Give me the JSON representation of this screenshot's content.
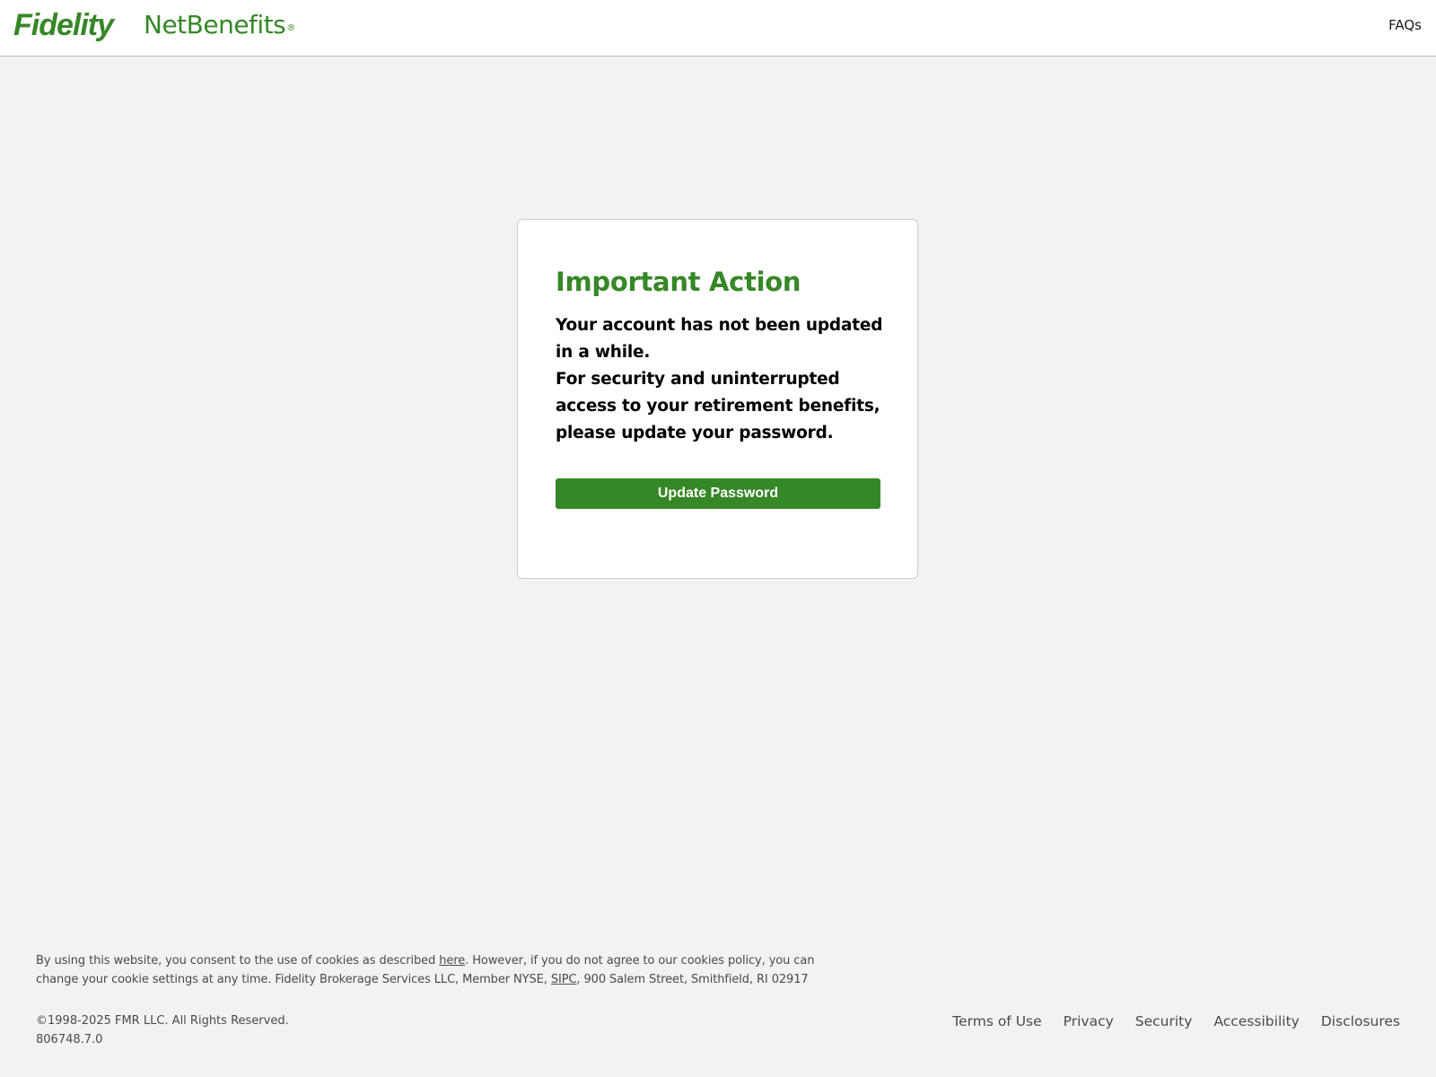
{
  "header": {
    "logo_primary": "Fidelity",
    "logo_secondary": "NetBenefits",
    "logo_registered": "®",
    "faqs_label": "FAQs"
  },
  "card": {
    "title": "Important Action",
    "message_line1": "Your account has not been updated in a while.",
    "message_line2": "For security and uninterrupted access to your retirement benefits, please update your password.",
    "button_label": "Update Password"
  },
  "footer": {
    "consent_prefix": "By using this website, you consent to the use of cookies as described ",
    "consent_link": "here",
    "consent_middle": ". However, if you do not agree to our cookies policy, you can change your cookie settings at any time. Fidelity Brokerage Services LLC, Member NYSE, ",
    "sipc_link": "SIPC",
    "consent_suffix": ", 900 Salem Street, Smithfield, RI 02917",
    "copyright": "©1998-2025 FMR LLC. All Rights Reserved.",
    "version": "806748.7.0",
    "links": [
      "Terms of Use",
      "Privacy",
      "Security",
      "Accessibility",
      "Disclosures"
    ]
  },
  "colors": {
    "brand_green": "#368727",
    "title_green": "#368727",
    "background": "#f2f2f2"
  }
}
